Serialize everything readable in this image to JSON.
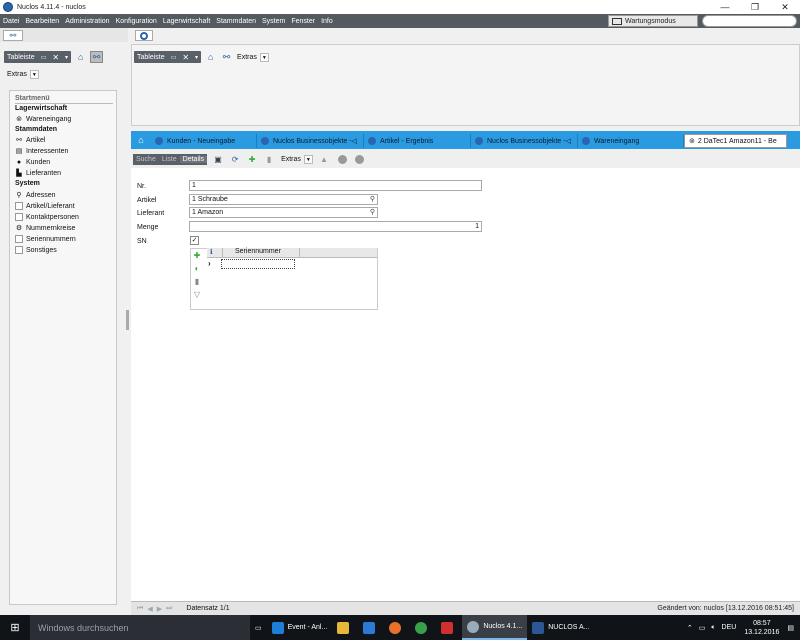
{
  "window": {
    "title": "Nuclos 4.11.4 - nuclos",
    "minimize": "—",
    "maximize": "❐",
    "close": "✕"
  },
  "menu": [
    "Datei",
    "Bearbeiten",
    "Administration",
    "Konfiguration",
    "Lagerwirtschaft",
    "Stammdaten",
    "System",
    "Fenster",
    "Info"
  ],
  "header": {
    "maintenance_label": "Wartungsmodus",
    "search_placeholder": ""
  },
  "left": {
    "tableiste": "Tableiste",
    "extras": "Extras",
    "startmenu": {
      "title": "Startmenü",
      "groups": [
        {
          "label": "Lagerwirtschaft",
          "items": [
            {
              "label": "Wareneingang",
              "icon": "download-icon"
            }
          ]
        },
        {
          "label": "Stammdaten",
          "items": [
            {
              "label": "Artikel",
              "icon": "tree-icon"
            },
            {
              "label": "Interessenten",
              "icon": "table-icon"
            },
            {
              "label": "Kunden",
              "icon": "person-icon"
            },
            {
              "label": "Lieferanten",
              "icon": "truck-icon"
            }
          ]
        },
        {
          "label": "System",
          "items": [
            {
              "label": "Adressen",
              "icon": "pin-icon"
            },
            {
              "label": "Artikel/Lieferant",
              "icon": "box-icon"
            },
            {
              "label": "Kontaktpersonen",
              "icon": "box-icon"
            },
            {
              "label": "Nummernkreise",
              "icon": "gear-icon"
            },
            {
              "label": "Seriennummern",
              "icon": "box-icon"
            },
            {
              "label": "Sonstiges",
              "icon": "box-icon"
            }
          ]
        }
      ]
    }
  },
  "right": {
    "tableiste": "Tableiste",
    "extras": "Extras"
  },
  "tabs": [
    "Kunden - Neueingabe",
    "Nuclos Businessobjekte -◁",
    "Artikel - Ergebnis",
    "Nuclos Businessobjekte -◁",
    "Wareneingang",
    "2 DaTec1 Amazon11 - Be"
  ],
  "detail_toolbar": {
    "search": "Suche",
    "list": "Liste",
    "details": "Details",
    "extras": "Extras"
  },
  "form": {
    "nr_label": "Nr.",
    "nr_value": "1",
    "artikel_label": "Artikel",
    "artikel_value": "1 Schraube",
    "lieferant_label": "Lieferant",
    "lieferant_value": "1 Amazon",
    "menge_label": "Menge",
    "menge_value": "1",
    "sn_label": "SN",
    "sn_checked": "✓",
    "subform_header": "Seriennummer"
  },
  "status": {
    "record": "Datensatz 1/1",
    "changed": "Geändert von: nuclos [13.12.2016 08:51:45]"
  },
  "taskbar": {
    "search_placeholder": "Windows durchsuchen",
    "apps": [
      "Event - Anl...",
      "Nuclos 4.1...",
      "NUCLOS A..."
    ],
    "lang": "DEU",
    "time": "08:57",
    "date": "13.12.2016"
  }
}
